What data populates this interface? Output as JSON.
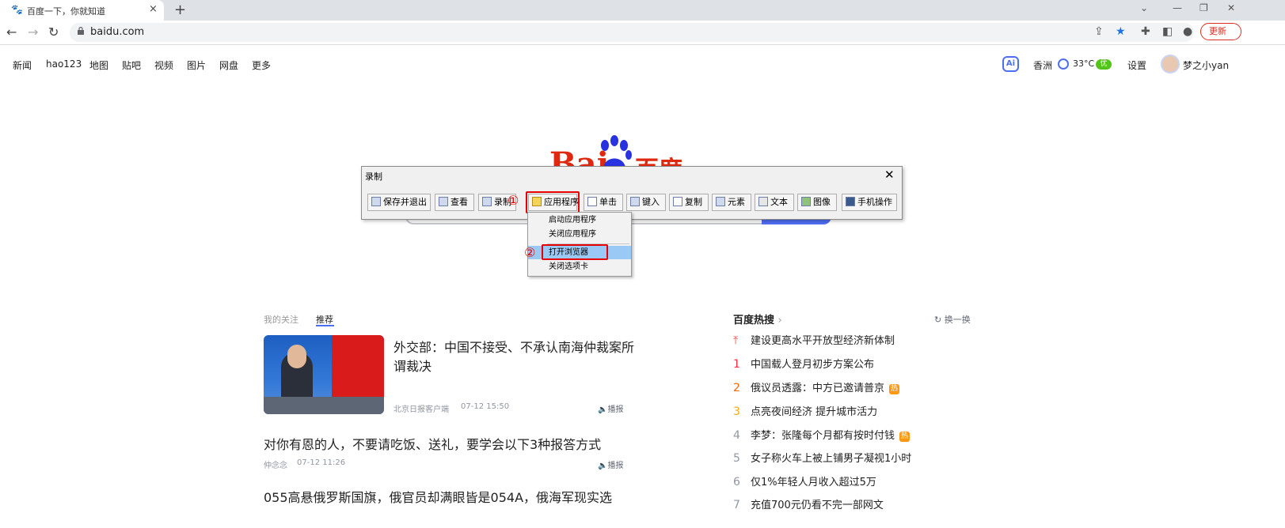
{
  "browser": {
    "tab_title": "百度一下，你就知道",
    "tab_close": "×",
    "new_tab": "+",
    "url": "baidu.com",
    "update_label": "更新"
  },
  "baidu": {
    "nav": [
      "新闻",
      "hao123",
      "地图",
      "贴吧",
      "视频",
      "图片",
      "网盘",
      "更多"
    ],
    "ai_label": "Ai",
    "city": "香洲",
    "temperature": "33°C",
    "aqi": "优",
    "settings": "设置",
    "username": "梦之小yan",
    "logo_bai": "Bai",
    "logo_du": "百度"
  },
  "recorder": {
    "title": "录制",
    "close": "✕",
    "buttons": [
      "保存并退出",
      "查看",
      "录制",
      "应用程序",
      "单击",
      "键入",
      "复制",
      "元素",
      "文本",
      "图像",
      "手机操作"
    ],
    "menu": [
      "启动应用程序",
      "关闭应用程序",
      "打开浏览器",
      "关闭选项卡"
    ],
    "marker1": "①",
    "marker2": "②"
  },
  "feed": {
    "tab_follow": "我的关注",
    "tab_recommend": "推荐",
    "items": [
      {
        "title": "外交部：中国不接受、不承认南海仲裁案所谓裁决",
        "source": "北京日报客户端",
        "time": "07-12 15:50",
        "report": "播报"
      },
      {
        "title": "对你有恩的人，不要请吃饭、送礼，要学会以下3种报答方式",
        "source": "仲念念",
        "time": "07-12 11:26",
        "report": "播报"
      },
      {
        "title": "055高悬俄罗斯国旗，俄官员却满眼皆是054A，俄海军现实选"
      }
    ]
  },
  "hotlist": {
    "title": "百度热搜",
    "refresh": "换一换",
    "hot_badge": "热",
    "items": [
      {
        "rank": "",
        "text": "建设更高水平开放型经济新体制",
        "color": "#f54545",
        "hot": false
      },
      {
        "rank": "1",
        "text": "中国载人登月初步方案公布",
        "color": "#fe2d46",
        "hot": false
      },
      {
        "rank": "2",
        "text": "俄议员透露：中方已邀请普京",
        "color": "#f60",
        "hot": true
      },
      {
        "rank": "3",
        "text": "点亮夜间经济 提升城市活力",
        "color": "#faa90e",
        "hot": false
      },
      {
        "rank": "4",
        "text": "李梦：张隆每个月都有按时付钱",
        "color": "#9195a3",
        "hot": true
      },
      {
        "rank": "5",
        "text": "女子称火车上被上铺男子凝视1小时",
        "color": "#9195a3",
        "hot": false
      },
      {
        "rank": "6",
        "text": "仅1%年轻人月收入超过5万",
        "color": "#9195a3",
        "hot": false
      },
      {
        "rank": "7",
        "text": "充值700元仍看不完一部网文",
        "color": "#9195a3",
        "hot": false
      }
    ]
  }
}
